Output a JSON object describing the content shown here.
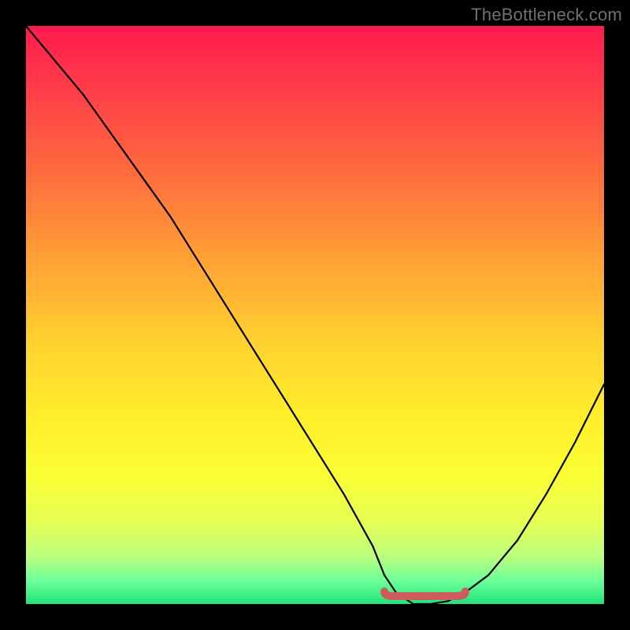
{
  "watermark": "TheBottleneck.com",
  "colors": {
    "frame": "#000000",
    "curve": "#000000",
    "marker": "#cd5c5c",
    "gradient_stops": [
      "#ff1a4d",
      "#ff3a4a",
      "#ff6a3e",
      "#ffa035",
      "#ffd22f",
      "#ffef2a",
      "#faff35",
      "#e4ff55",
      "#b8ff80",
      "#6cff9a",
      "#22e37a"
    ]
  },
  "chart_data": {
    "type": "line",
    "title": "",
    "xlabel": "",
    "ylabel": "",
    "xlim": [
      0,
      100
    ],
    "ylim": [
      0,
      100
    ],
    "series": [
      {
        "name": "bottleneck-curve",
        "x": [
          0,
          5,
          10,
          15,
          20,
          25,
          30,
          35,
          40,
          45,
          50,
          55,
          60,
          62,
          64,
          67,
          70,
          73,
          76,
          80,
          85,
          90,
          95,
          100
        ],
        "values": [
          100,
          94,
          88,
          81,
          74,
          67,
          59,
          51,
          43,
          35,
          27,
          19,
          10,
          5,
          2,
          0,
          0,
          0.5,
          2,
          5,
          11,
          19,
          28,
          38
        ]
      }
    ],
    "annotations": [
      {
        "name": "optimal-range-marker",
        "x": [
          62,
          76
        ],
        "y": [
          0,
          0
        ]
      }
    ]
  }
}
